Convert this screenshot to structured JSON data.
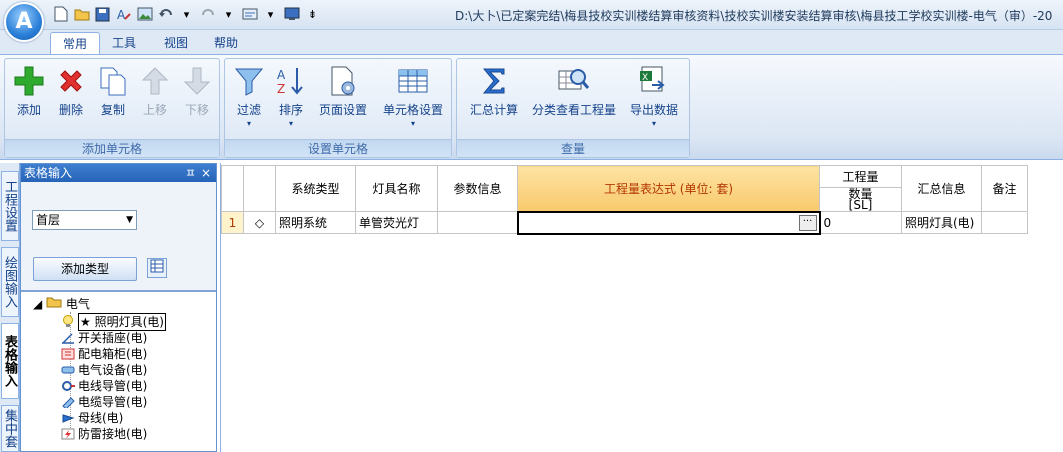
{
  "app": {
    "orb_label": "A",
    "title": "D:\\大卜\\已定案完结\\梅县技校实训楼结算审核资料\\技校实训楼安装结算审核\\梅县技工学校实训楼-电气（审）-20"
  },
  "qat": [
    "new-doc-icon",
    "open-folder-icon",
    "save-icon",
    "font-icon",
    "image-icon",
    "undo-icon",
    "redo-icon",
    "view-icon",
    "screen-icon"
  ],
  "ribbon_tabs": [
    "常用",
    "工具",
    "视图",
    "帮助"
  ],
  "groups": {
    "cells": {
      "label": "添加单元格",
      "buttons": {
        "add": "添加",
        "delete": "删除",
        "copy": "复制",
        "up": "上移",
        "down": "下移"
      }
    },
    "settings": {
      "label": "设置单元格",
      "buttons": {
        "filter": "过滤",
        "sort": "排序",
        "page": "页面设置",
        "cell": "单元格设置"
      }
    },
    "quantity": {
      "label": "查量",
      "buttons": {
        "sum": "汇总计算",
        "classify": "分类查看工程量",
        "export": "导出数据"
      }
    }
  },
  "colors": {
    "accent": "#2563b8",
    "header_highlight": "#f9c96c",
    "ribbon_bg": "#dbe6f4"
  },
  "side_tabs": [
    "工程设置",
    "绘图输入",
    "表格输入",
    "集中套"
  ],
  "panel": {
    "title": "表格输入",
    "pin": "ㅍ",
    "close": "×",
    "floor": "首层",
    "add_type": "添加类型"
  },
  "tree": {
    "root": "电气",
    "items": [
      {
        "label": "★ 照明灯具(电)",
        "icon": "bulb-icon"
      },
      {
        "label": "开关插座(电)",
        "icon": "switch-icon"
      },
      {
        "label": "配电箱柜(电)",
        "icon": "cabinet-icon"
      },
      {
        "label": "电气设备(电)",
        "icon": "device-icon"
      },
      {
        "label": "电线导管(电)",
        "icon": "wire-icon"
      },
      {
        "label": "电缆导管(电)",
        "icon": "cable-icon"
      },
      {
        "label": "母线(电)",
        "icon": "busbar-icon"
      },
      {
        "label": "防雷接地(电)",
        "icon": "lightning-icon"
      }
    ]
  },
  "grid": {
    "headers": {
      "sys_type": "系统类型",
      "lamp_name": "灯具名称",
      "params": "参数信息",
      "expr": "工程量表达式 (单位: 套)",
      "qty_group": "工程量",
      "qty": "数量",
      "qty_code": "[SL]",
      "summary": "汇总信息",
      "note": "备注"
    },
    "rows": [
      {
        "num": "1",
        "marker": "◇",
        "sys_type": "照明系统",
        "lamp_name": "单管荧光灯",
        "params": "",
        "expr": "",
        "qty": "0",
        "summary": "照明灯具(电)",
        "note": ""
      }
    ]
  }
}
